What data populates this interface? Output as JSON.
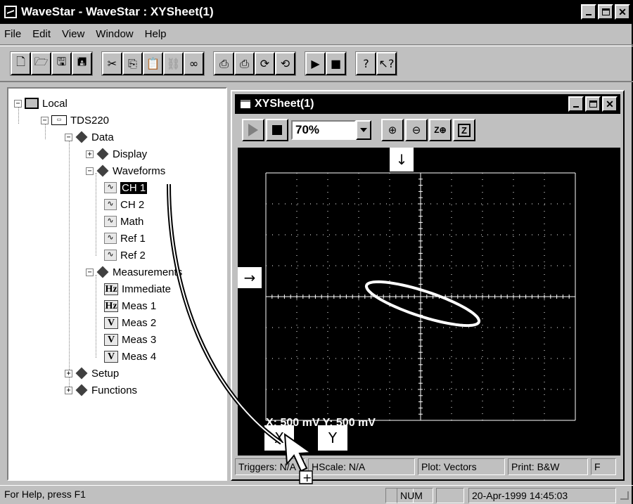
{
  "window": {
    "title": "WaveStar - WaveStar : XYSheet(1)"
  },
  "menu": {
    "items": [
      "File",
      "Edit",
      "View",
      "Window",
      "Help"
    ]
  },
  "tree": {
    "root": "Local",
    "instrument": "TDS220",
    "data": "Data",
    "display": "Display",
    "waveforms": "Waveforms",
    "ch1": "CH 1",
    "ch2": "CH 2",
    "math": "Math",
    "ref1": "Ref 1",
    "ref2": "Ref 2",
    "measurements": "Measurements",
    "immediate": "Immediate",
    "meas1": "Meas 1",
    "meas2": "Meas 2",
    "meas3": "Meas 3",
    "meas4": "Meas 4",
    "setup": "Setup",
    "functions": "Functions"
  },
  "xysheet": {
    "title": "XYSheet(1)",
    "zoom": "70%",
    "scale_label": "X: 500 mV    Y: 500 mV",
    "x_button": "X",
    "y_button": "Y"
  },
  "child_status": {
    "triggers": "Triggers: N/A",
    "hscale": "HScale: N/A",
    "plot": "Plot: Vectors",
    "print": "Print: B&W",
    "extra": "F"
  },
  "status": {
    "help": "For Help, press F1",
    "num": "NUM",
    "datetime": "20-Apr-1999 14:45:03"
  }
}
